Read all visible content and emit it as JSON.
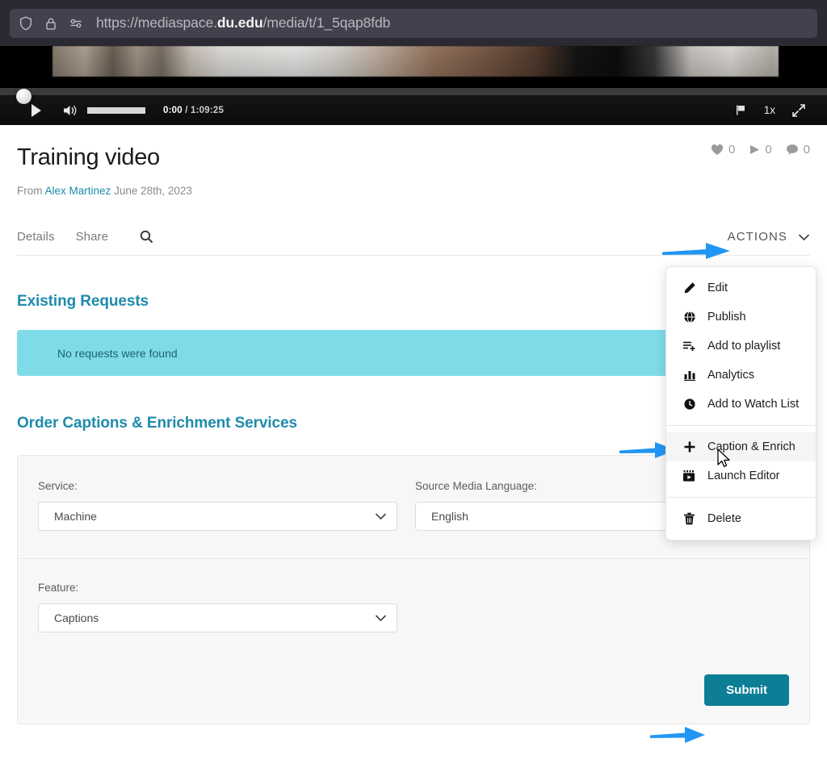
{
  "browser": {
    "url_prefix": "https://mediaspace.",
    "url_domain": "du.edu",
    "url_suffix": "/media/t/1_5qap8fdb",
    "icons": [
      "shield-icon",
      "lock-icon",
      "tracking-protection-icon"
    ]
  },
  "player": {
    "current_time": "0:00",
    "total_time": "/ 1:09:25",
    "speed": "1x",
    "icons": [
      "play-icon",
      "volume-icon",
      "flag-icon",
      "fullscreen-icon"
    ]
  },
  "media": {
    "title": "Training video",
    "from_label": "From",
    "author": "Alex Martinez",
    "date": "June 28th, 2023",
    "stats": [
      {
        "icon": "heart-icon",
        "count": "0"
      },
      {
        "icon": "play-icon",
        "count": "0"
      },
      {
        "icon": "comment-icon",
        "count": "0"
      }
    ]
  },
  "tabs": {
    "items": [
      {
        "label": "Details"
      },
      {
        "label": "Share"
      }
    ],
    "search_icon": "search-icon",
    "actions_label": "ACTIONS",
    "actions_chevron": "chevron-down-icon"
  },
  "actions_menu": {
    "items": [
      {
        "label": "Edit",
        "icon": "pencil-icon",
        "hover": false,
        "separator_after": false
      },
      {
        "label": "Publish",
        "icon": "globe-icon",
        "hover": false,
        "separator_after": false
      },
      {
        "label": "Add to playlist",
        "icon": "playlist-add-icon",
        "hover": false,
        "separator_after": false
      },
      {
        "label": "Analytics",
        "icon": "bar-chart-icon",
        "hover": false,
        "separator_after": false
      },
      {
        "label": "Add to Watch List",
        "icon": "clock-icon",
        "hover": false,
        "separator_after": true
      },
      {
        "label": "Caption & Enrich",
        "icon": "plus-icon",
        "hover": true,
        "separator_after": false
      },
      {
        "label": "Launch Editor",
        "icon": "film-icon",
        "hover": false,
        "separator_after": true
      },
      {
        "label": "Delete",
        "icon": "trash-icon",
        "hover": false,
        "separator_after": false
      }
    ]
  },
  "existing_requests": {
    "heading": "Existing Requests",
    "empty_message": "No requests were found"
  },
  "order_form": {
    "heading": "Order Captions & Enrichment Services",
    "fields": [
      {
        "label": "Service:",
        "value": "Machine"
      },
      {
        "label": "Source Media Language:",
        "value": "English"
      },
      {
        "label": "Feature:",
        "value": "Captions"
      }
    ],
    "submit_label": "Submit"
  },
  "colors": {
    "brand_teal": "#1e8bab",
    "submit_teal": "#0c7e96",
    "alert_cyan": "#80dbe8",
    "arrow_blue": "#2196f3",
    "chrome_dark": "#2b2a33"
  }
}
